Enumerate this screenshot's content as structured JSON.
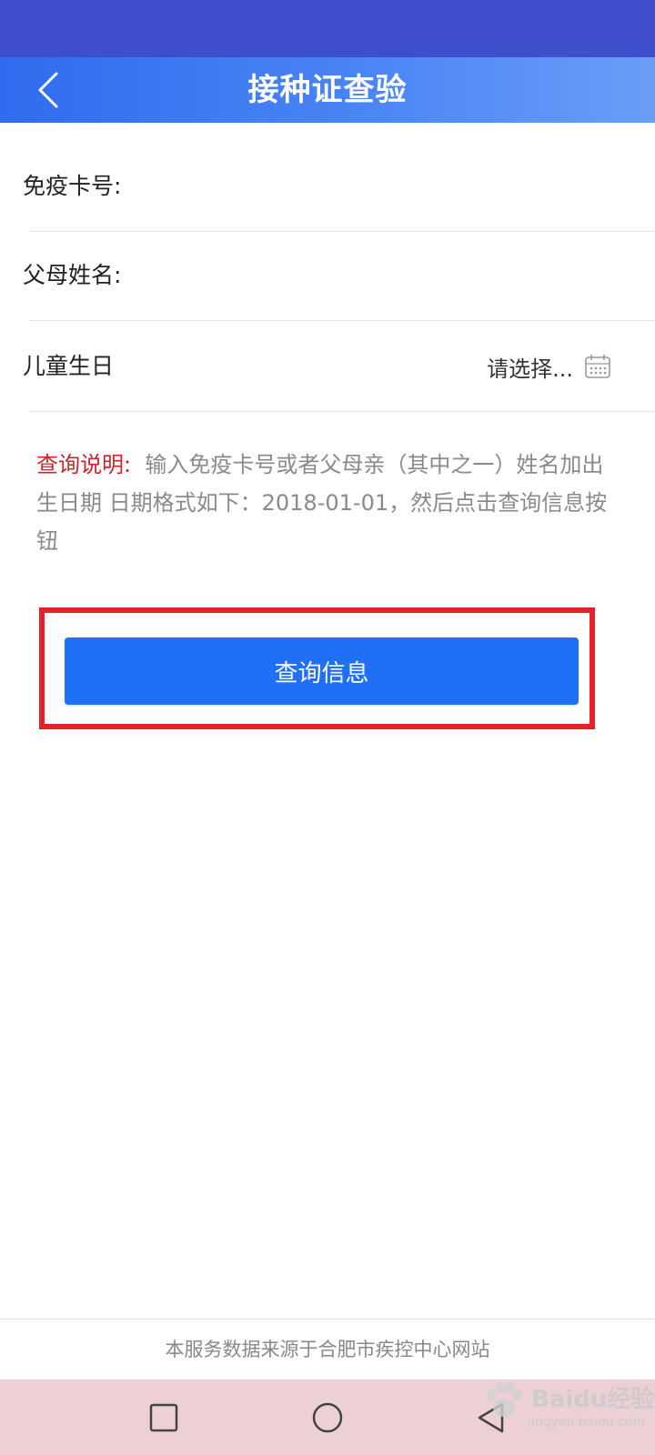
{
  "header": {
    "title": "接种证查验"
  },
  "form": {
    "card_number_label": "免疫卡号:",
    "parent_name_label": "父母姓名:",
    "birthday_label": "儿童生日",
    "birthday_placeholder": "请选择..."
  },
  "notice": {
    "label": "查询说明:",
    "text": "输入免疫卡号或者父母亲（其中之一）姓名加出生日期 日期格式如下：2018-01-01，然后点击查询信息按钮"
  },
  "actions": {
    "query_label": "查询信息"
  },
  "footer": {
    "text": "本服务数据来源于合肥市疾控中心网站"
  },
  "watermark": {
    "brand": "Baidu经验",
    "url": "jingyan.baidu.com"
  },
  "colors": {
    "header_gradient_start": "#2f6cf0",
    "header_gradient_end": "#6a9cf8",
    "status_bar": "#3f4ecb",
    "primary_button": "#1f6ff7",
    "notice_label": "#c8252c",
    "highlight_border": "#e8202a",
    "nav_bar": "#ecd0d6"
  },
  "icons": {
    "back": "chevron-left-icon",
    "calendar": "calendar-icon",
    "recent_apps": "square-icon",
    "home": "circle-icon",
    "system_back": "triangle-back-icon"
  }
}
